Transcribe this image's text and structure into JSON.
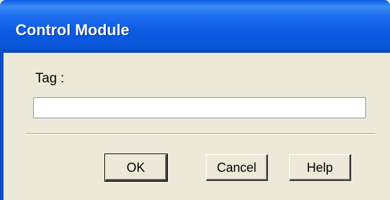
{
  "window": {
    "title": "Control Module"
  },
  "form": {
    "tag_label": "Tag :",
    "tag_value": "",
    "tag_placeholder": ""
  },
  "buttons": {
    "ok_label": "OK",
    "cancel_label": "Cancel",
    "help_label": "Help"
  },
  "colors": {
    "titlebar": "#0a5ee8",
    "dialog_background": "#ece9d8",
    "title_text": "#ffffff"
  }
}
